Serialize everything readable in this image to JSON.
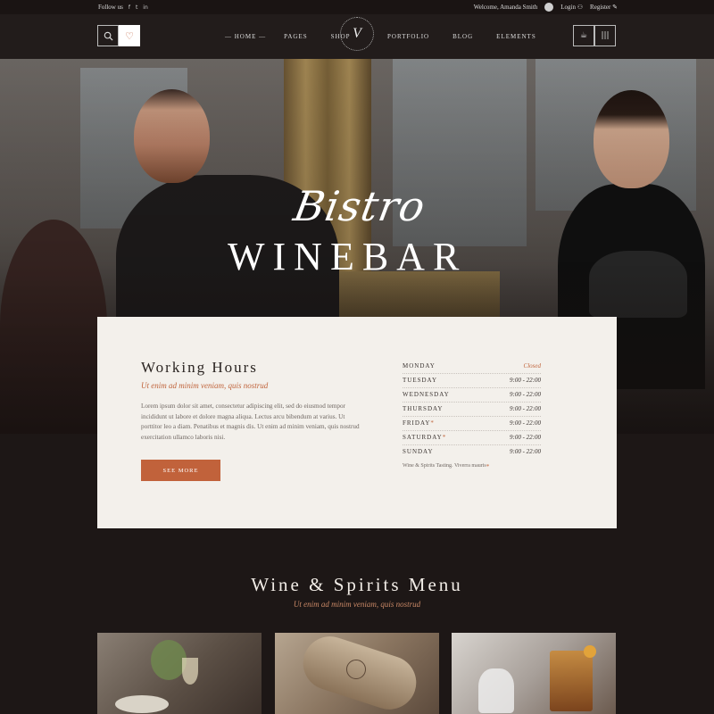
{
  "topbar": {
    "follow_label": "Follow us",
    "social_icons": [
      "f",
      "t",
      "in"
    ],
    "welcome": "Welcome, Amanda Smith",
    "login": "Login",
    "register": "Register"
  },
  "header": {
    "nav_left": [
      "Home",
      "Pages",
      "Shop"
    ],
    "nav_right": [
      "Portfolio",
      "Blog",
      "Elements"
    ],
    "logo_letter": "V",
    "active_item": "Home"
  },
  "hero": {
    "script_title": "Bistro",
    "big_title": "WINEBAR"
  },
  "working_hours": {
    "title": "Working Hours",
    "subtitle": "Ut enim ad minim veniam, quis nostrud",
    "paragraph": "Lorem ipsum dolor sit amet, consectetur adipiscing elit, sed do eiusmod tempor incididunt ut labore et dolore magna aliqua. Lectus arcu bibendum at varius. Ut porttitor leo a diam. Penatibus et magnis dis. Ut enim ad minim veniam, quis nostrud exercitation ullamco laboris nisi.",
    "button": "See More",
    "hours": [
      {
        "day": "Monday",
        "time": "Closed",
        "starred": false,
        "closed": true
      },
      {
        "day": "Tuesday",
        "time": "9:00 - 22:00",
        "starred": false,
        "closed": false
      },
      {
        "day": "Wednesday",
        "time": "9:00 - 22:00",
        "starred": false,
        "closed": false
      },
      {
        "day": "Thursday",
        "time": "9:00 - 22:00",
        "starred": false,
        "closed": false
      },
      {
        "day": "Friday",
        "time": "9:00 - 22:00",
        "starred": true,
        "closed": false
      },
      {
        "day": "Saturday",
        "time": "9:00 - 22:00",
        "starred": true,
        "closed": false
      },
      {
        "day": "Sunday",
        "time": "9:00 - 22:00",
        "starred": false,
        "closed": false
      }
    ],
    "note": "Wine & Spirits Tasting. Viverra mauris"
  },
  "menu_section": {
    "title": "Wine & Spirits Menu",
    "subtitle": "Ut enim ad minim veniam, quis nostrud"
  },
  "colors": {
    "accent": "#c1623b",
    "dark_bg": "#1d1716",
    "card_bg": "#f3f0eb"
  }
}
